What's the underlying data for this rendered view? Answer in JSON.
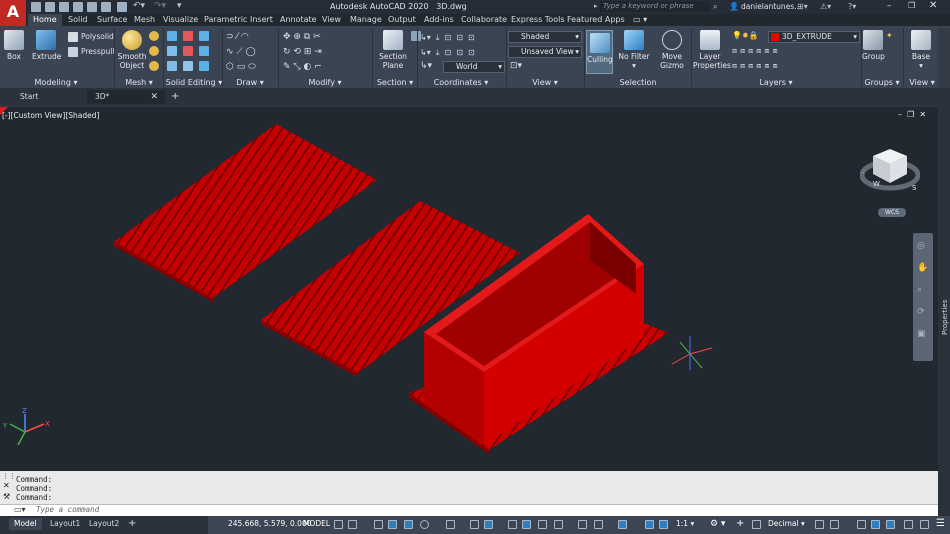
{
  "app": {
    "logo": "A",
    "title": "Autodesk AutoCAD 2020",
    "file": "3D.dwg",
    "search_placeholder": "Type a keyword or phrase",
    "user": "danielantunes..."
  },
  "ribbon_tabs": [
    "Home",
    "Solid",
    "Surface",
    "Mesh",
    "Visualize",
    "Parametric",
    "Insert",
    "Annotate",
    "View",
    "Manage",
    "Output",
    "Add-ins",
    "Collaborate",
    "Express Tools",
    "Featured Apps"
  ],
  "active_tab": "Home",
  "panels": {
    "modeling": {
      "label": "Modeling",
      "box": "Box",
      "extrude": "Extrude",
      "polysolid": "Polysolid",
      "presspull": "Presspull"
    },
    "mesh": {
      "label": "Mesh",
      "smooth_object": "Smooth Object"
    },
    "solid_editing": {
      "label": "Solid Editing"
    },
    "draw": {
      "label": "Draw"
    },
    "modify": {
      "label": "Modify"
    },
    "section": {
      "label": "Section",
      "section_plane": "Section Plane"
    },
    "coordinates": {
      "label": "Coordinates",
      "ucs": "World"
    },
    "view": {
      "label": "View",
      "visual_style": "Shaded",
      "named_view": "Unsaved View"
    },
    "selection": {
      "label": "Selection",
      "culling": "Culling",
      "no_filter": "No Filter",
      "move_gizmo": "Move Gizmo"
    },
    "layers": {
      "label": "Layers",
      "layer_properties": "Layer Properties",
      "current_layer": "3D_EXTRUDE"
    },
    "groups": {
      "label": "Groups",
      "group": "Group"
    },
    "view2": {
      "label": "View",
      "base": "Base"
    }
  },
  "doc_tabs": [
    {
      "label": "Start"
    },
    {
      "label": "3D*"
    }
  ],
  "viewport": {
    "label": "[-][Custom View][Shaded]",
    "viewcube_label": "WCS",
    "properties_label": "Properties",
    "compass": {
      "w": "W",
      "s": "S"
    },
    "axis": {
      "x": "X",
      "y": "Y",
      "z": "Z"
    },
    "object_color": "#cc0000"
  },
  "command_history": [
    "Command:",
    "Command:",
    "Command:"
  ],
  "command_placeholder": "Type a command",
  "status": {
    "tabs": [
      "Model",
      "Layout1",
      "Layout2"
    ],
    "coords": "245.668, 5.579, 0.000",
    "mode": "MODEL",
    "scale": "1:1",
    "units": "Decimal"
  }
}
